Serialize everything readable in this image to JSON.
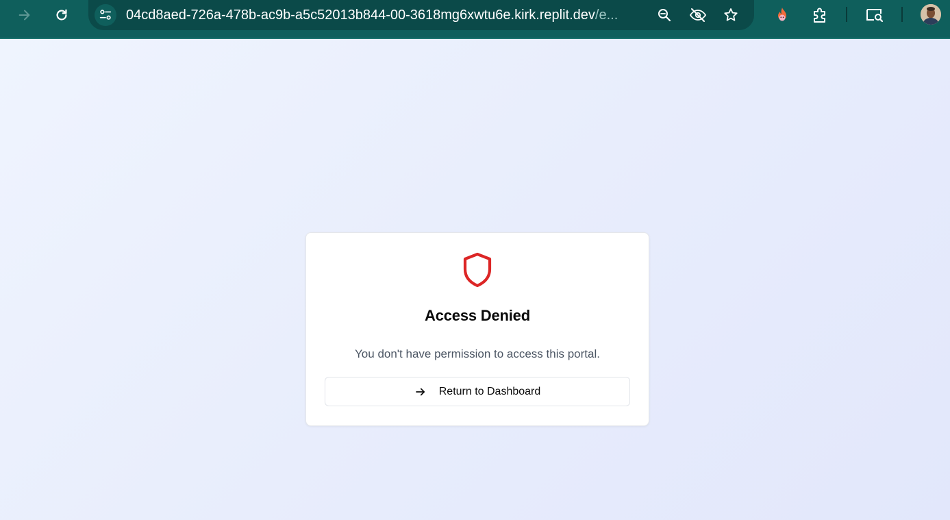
{
  "browser": {
    "url_host": "04cd8aed-726a-478b-ac9b-a5c52013b844-00-3618mg6xwtu6e.kirk.replit.dev",
    "url_rest": "/e...",
    "icons": {
      "forward": "arrow-forward-icon",
      "reload": "reload-icon",
      "site_info": "site-settings-icon",
      "zoom": "zoom-icon",
      "tracking": "eye-off-icon",
      "bookmark": "star-icon",
      "extension_fire": "fire-extension-icon",
      "extensions": "puzzle-icon",
      "tab_search": "tab-search-icon",
      "profile": "avatar"
    },
    "colors": {
      "toolbar": "#0f5f5c",
      "omnibox": "#0b4a49"
    }
  },
  "page": {
    "icon": "shield-icon",
    "title": "Access Denied",
    "message": "You don't have permission to access this portal.",
    "return_button_label": "Return to Dashboard",
    "accent_color": "#dc2626"
  }
}
